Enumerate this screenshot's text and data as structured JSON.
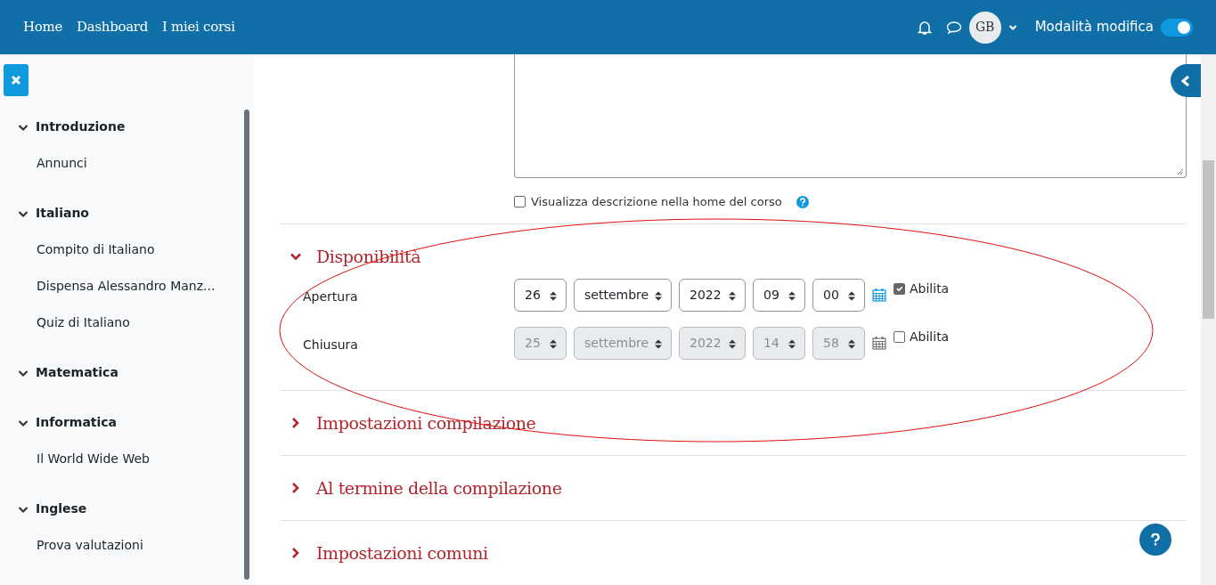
{
  "navbar": {
    "links": [
      {
        "label": "Home"
      },
      {
        "label": "Dashboard"
      },
      {
        "label": "I miei corsi"
      }
    ],
    "user_initials": "GB",
    "edit_mode": {
      "label": "Modalità modifica",
      "on": true
    }
  },
  "sidebar": {
    "sections": [
      {
        "title": "Introduzione",
        "expanded": true,
        "children": [
          {
            "label": "Annunci"
          }
        ]
      },
      {
        "title": "Italiano",
        "expanded": true,
        "children": [
          {
            "label": "Compito di Italiano"
          },
          {
            "label": "Dispensa Alessandro Manz..."
          },
          {
            "label": "Quiz di Italiano"
          }
        ]
      },
      {
        "title": "Matematica",
        "expanded": true
      },
      {
        "title": "Informatica",
        "expanded": true,
        "children": [
          {
            "label": "Il World Wide Web"
          }
        ]
      },
      {
        "title": "Inglese",
        "expanded": true,
        "children": [
          {
            "label": "Prova valutazioni"
          }
        ]
      }
    ]
  },
  "description_option": {
    "label": "Visualizza descrizione nella home del corso",
    "checked": false
  },
  "sections": [
    {
      "title": "Disponibilità",
      "expanded": true,
      "fields": [
        {
          "label": "Apertura",
          "day": "26",
          "month": "settembre",
          "year": "2022",
          "hour": "09",
          "minute": "00",
          "enable_label": "Abilita",
          "checked": true
        },
        {
          "label": "Chiusura",
          "day": "25",
          "month": "settembre",
          "year": "2022",
          "hour": "14",
          "minute": "58",
          "enable_label": "Abilita",
          "checked": false
        }
      ]
    },
    {
      "title": "Impostazioni compilazione",
      "expanded": false
    },
    {
      "title": "Al termine della compilazione",
      "expanded": false
    },
    {
      "title": "Impostazioni comuni",
      "expanded": false
    }
  ]
}
